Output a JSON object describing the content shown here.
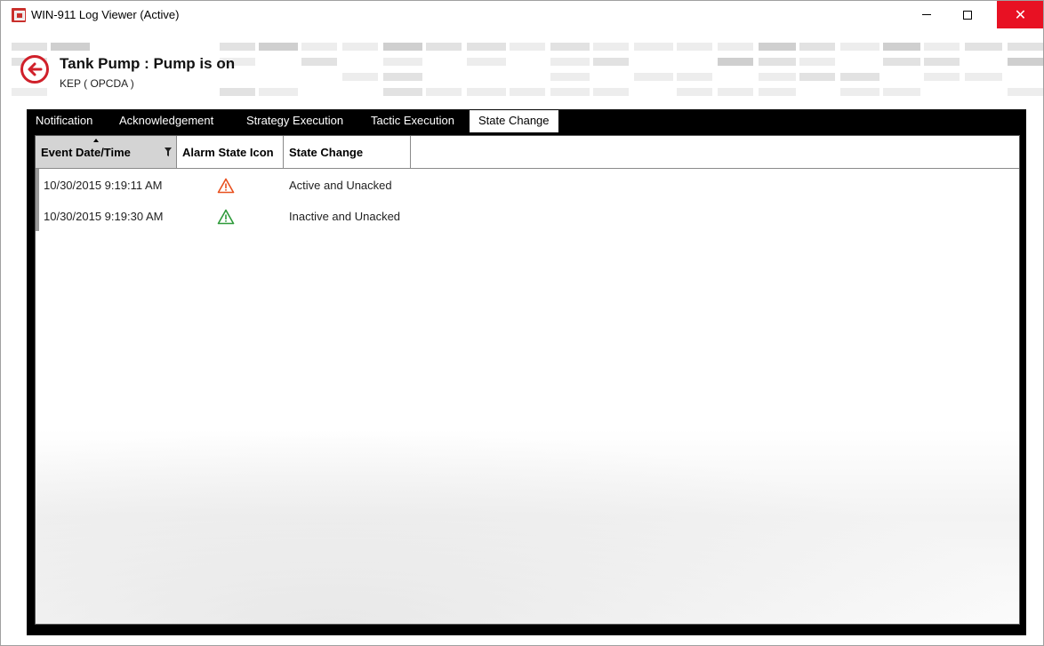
{
  "window": {
    "title": "WIN-911 Log Viewer (Active)",
    "controls": {
      "close_glyph": "✕"
    }
  },
  "header": {
    "alarm_title": "Tank Pump   : Pump is on",
    "source": "KEP  ( OPCDA )"
  },
  "tabs": [
    {
      "label": "Notification",
      "active": false
    },
    {
      "label": "Acknowledgement",
      "active": false
    },
    {
      "label": "Strategy Execution",
      "active": false
    },
    {
      "label": "Tactic Execution",
      "active": false
    },
    {
      "label": "State Change",
      "active": true
    }
  ],
  "grid": {
    "columns": [
      "Event Date/Time",
      "Alarm State Icon",
      "State Change"
    ],
    "sorted_column": "Event Date/Time",
    "sort_direction": "ascending",
    "rows": [
      {
        "datetime": "10/30/2015 9:19:11 AM",
        "icon": "warning-triangle-icon",
        "icon_color": "#e8501e",
        "state": "Active and Unacked"
      },
      {
        "datetime": "10/30/2015 9:19:30 AM",
        "icon": "warning-triangle-icon",
        "icon_color": "#2e9a3a",
        "state": "Inactive and Unacked"
      }
    ]
  },
  "colors": {
    "accent_red": "#d0202a",
    "close_button": "#e81123",
    "tab_bar": "#000000"
  }
}
